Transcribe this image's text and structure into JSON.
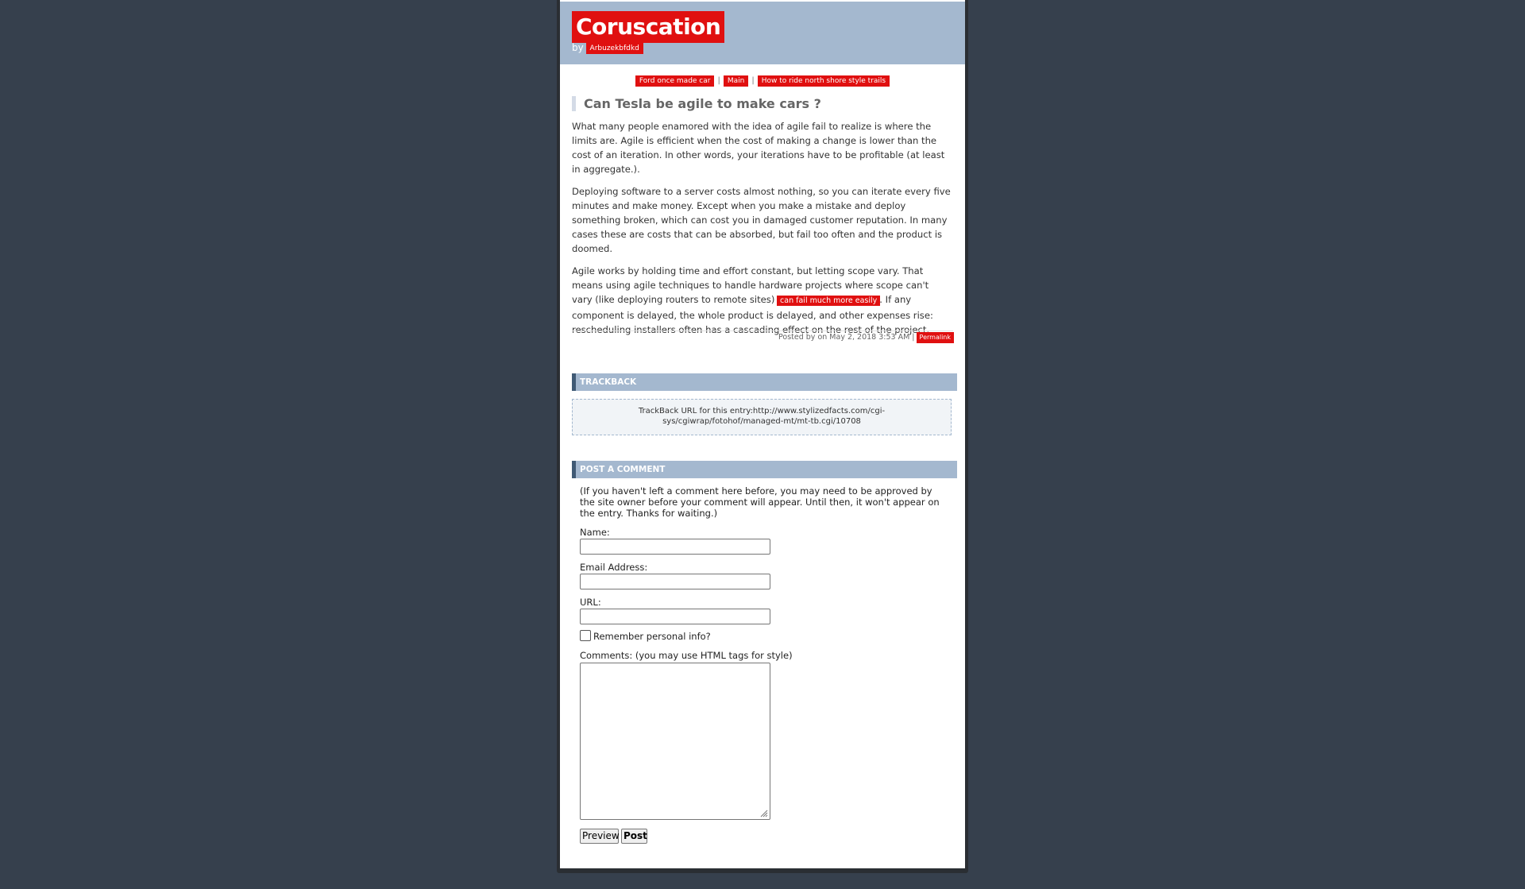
{
  "site": {
    "title": "Coruscation",
    "by_label": "by",
    "author": "Arbuzekbfdkd"
  },
  "nav": {
    "prev_link": "Ford once made car",
    "main_link": "Main",
    "next_link": "How to ride north shore style trails",
    "separator": "|"
  },
  "entry": {
    "title": "Can Tesla be agile to make cars ?",
    "paragraph_1": "What many people enamored with the idea of agile fail to realize is where the limits are. Agile is efficient when the cost of making a change is lower than the cost of an iteration. In other words, your iterations have to be profitable (at least in aggregate.).",
    "paragraph_2": "Deploying software to a server costs almost nothing, so you can iterate every five minutes and make money. Except when you make a mistake and deploy something broken, which can cost you in damaged customer reputation. In many cases these are costs that can be absorbed, but fail too often and the product is doomed.",
    "paragraph_3_a": "Agile works by holding time and effort constant, but letting scope vary. That means using agile techniques to handle hardware projects where scope can't vary (like deploying routers to remote sites) ",
    "paragraph_3_link": "can fail much more easily",
    "paragraph_3_b": ". If any component is delayed, the whole product is delayed, and other expenses rise: rescheduling installers often has a cascading effect on the rest of the project.",
    "footer_posted": "Posted by  on May 2, 2018 3:53 AM |",
    "permalink": "Permalink"
  },
  "trackback": {
    "heading": "TRACKBACK",
    "text": "TrackBack URL for this entry:http://www.stylizedfacts.com/cgi-sys/cgiwrap/fotohof/managed-mt/mt-tb.cgi/10708"
  },
  "comment_form": {
    "heading": "POST A COMMENT",
    "note": "(If you haven't left a comment here before, you may need to be approved by the site owner before your comment will appear. Until then, it won't appear on the entry. Thanks for waiting.)",
    "name_label": "Name:",
    "name_value": "",
    "email_label": "Email Address:",
    "email_value": "",
    "url_label": "URL:",
    "url_value": "",
    "remember_label": "Remember personal info?",
    "remember_checked": false,
    "comments_label": "Comments: (you may use HTML tags for style)",
    "comments_value": "",
    "preview_button": "Preview",
    "post_button": "Post"
  },
  "colors": {
    "background": "#36404d",
    "banner": "#a4b8cf",
    "section_accent": "#405a75",
    "redaction": "#e01010"
  }
}
